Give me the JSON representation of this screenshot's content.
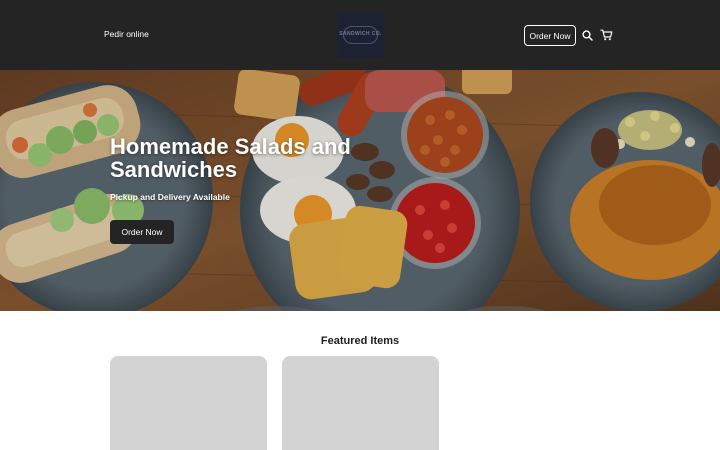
{
  "header": {
    "nav_link": "Pedir online",
    "logo_text": "SANDWICH CO.",
    "order_button": "Order Now",
    "icons": [
      "search-icon",
      "cart-icon"
    ]
  },
  "hero": {
    "title": "Homemade Salads and Sandwiches",
    "subtitle": "Pickup and Delivery Available",
    "button": "Order Now"
  },
  "featured": {
    "title": "Featured Items",
    "cards": [
      {
        "color": "#d3d3d3"
      },
      {
        "color": "#d3d3d3"
      }
    ]
  },
  "colors": {
    "header_bg": "#242424",
    "card_placeholder": "#d3d3d3",
    "button_bg": "#242424"
  }
}
